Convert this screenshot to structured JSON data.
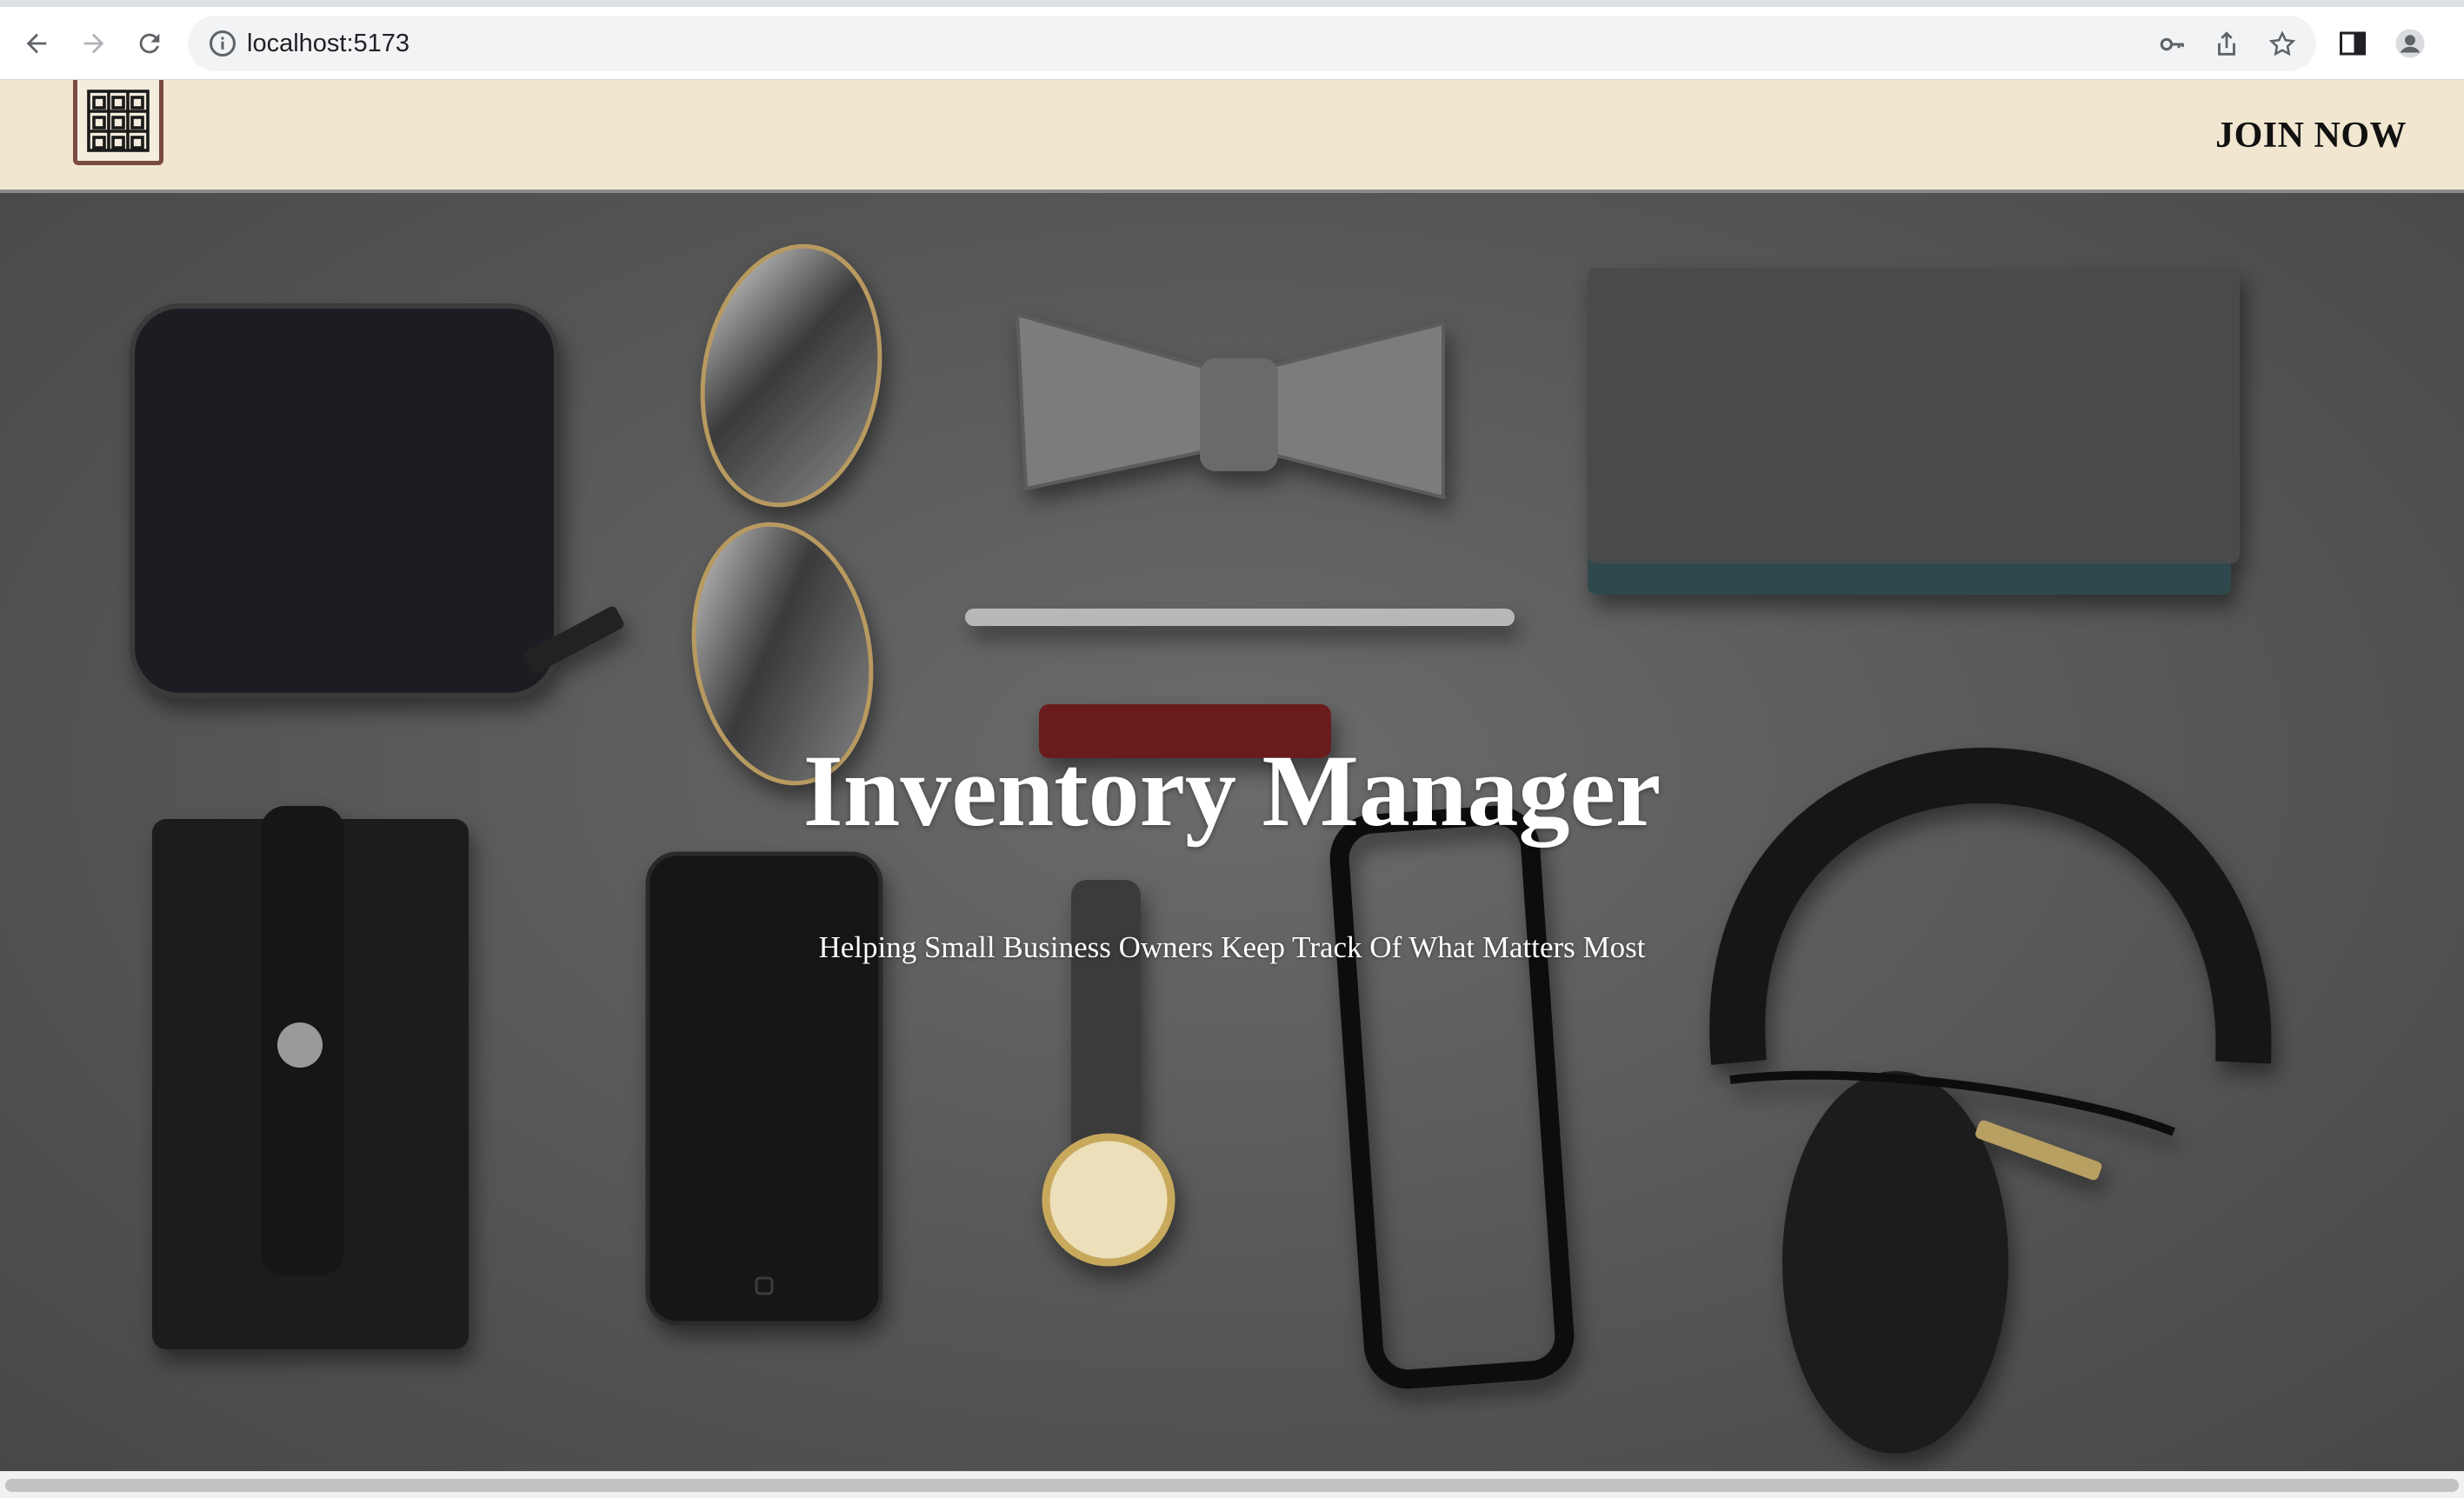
{
  "browser": {
    "url": "localhost:5173",
    "back_icon": "back-arrow-icon",
    "forward_icon": "forward-arrow-icon",
    "reload_icon": "reload-icon",
    "site_info_icon": "info-circle-icon",
    "toolbar_icons": [
      "key-icon",
      "share-icon",
      "star-icon",
      "side-panel-icon",
      "profile-avatar-icon"
    ]
  },
  "navbar": {
    "logo_icon": "warehouse-shelves-icon",
    "join_label": "JOIN NOW",
    "background": "#f1e7d0",
    "logo_border": "#7a4a3e"
  },
  "hero": {
    "title": "Inventory Manager",
    "subtitle": "Helping Small Business Owners Keep Track Of What Matters Most",
    "image_subject": "flat-lay of wallet, sunglasses, bow tie, pen, notebook, phone case, smartphone, wristwatch, eyeglasses, headphones"
  }
}
